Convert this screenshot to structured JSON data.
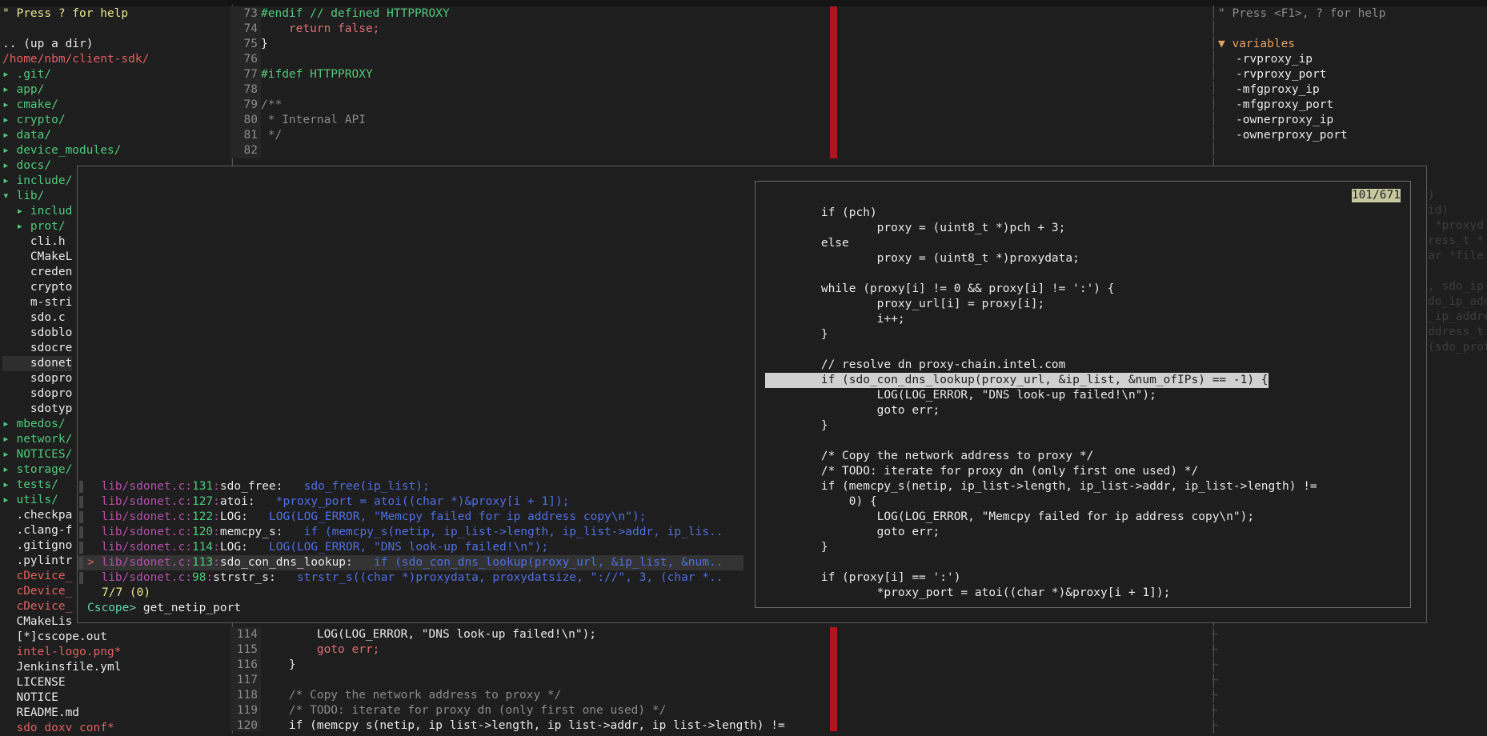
{
  "colors": {
    "background": "#1e1e1e",
    "directory": "#4ec97b",
    "path": "#e06060",
    "keyword": "#e06c75",
    "comment": "#8a8a8a",
    "cursor_bar": "#b0141c",
    "match_file": "#b54ea8",
    "match_text": "#4f6fe3"
  },
  "nerdtree": {
    "help": "\" Press ? for help",
    "up_dir": ".. (up a dir)",
    "root": "/home/nbm/client-sdk/",
    "items": [
      "▸ .git/",
      "▸ app/",
      "▸ cmake/",
      "▸ crypto/",
      "▸ data/",
      "▸ device_modules/",
      "▸ docs/",
      "▸ include/",
      "▾ lib/",
      "  ▸ includ",
      "  ▸ prot/",
      "    cli.h",
      "    CMakeL",
      "    creden",
      "    crypto",
      "    m-stri",
      "    sdo.c",
      "    sdoblo",
      "    sdocre",
      "    sdonet",
      "    sdopro",
      "    sdopro",
      "    sdotyp",
      "▸ mbedos/",
      "▸ network/",
      "▸ NOTICES/",
      "▸ storage/",
      "▸ tests/",
      "▸ utils/",
      "  .checkpa",
      "  .clang-f",
      "  .gitigno",
      "  .pylintr",
      "  cDevice_",
      "  cDevice_",
      "  cDevice_",
      "  CMakeLis",
      "  [*]cscope.out",
      "  intel-logo.png*",
      "  Jenkinsfile.yml",
      "  LICENSE",
      "  NOTICE",
      "  README.md",
      "  sdo_doxy_conf*"
    ]
  },
  "code_top": {
    "line_numbers": [
      "73",
      "74",
      "75",
      "76",
      "77",
      "78",
      "79",
      "80",
      "81",
      "82"
    ],
    "lines": [
      "#endif // defined HTTPPROXY",
      "    return false;",
      "}",
      "",
      "#ifdef HTTPPROXY",
      "",
      "/**",
      " * Internal API",
      " */",
      ""
    ]
  },
  "code_bottom": {
    "line_numbers": [
      "114",
      "115",
      "116",
      "117",
      "118",
      "119",
      "120"
    ],
    "lines": [
      "        LOG(LOG_ERROR, \"DNS look-up failed!\\n\");",
      "        goto err;",
      "    }",
      "",
      "    /* Copy the network address to proxy */",
      "    /* TODO: iterate for proxy dn (only first one used) */",
      "    if (memcpy_s(netip, ip_list->length, ip_list->addr, ip_list->length) !="
    ]
  },
  "tagbar": {
    "help": "\" Press <F1>, ? for help",
    "section": "▼ variables",
    "items": [
      "-rvproxy_ip",
      "-rvproxy_port",
      "-mfgproxy_ip",
      "-mfgproxy_port",
      "-ownerproxy_ip",
      "-ownerproxy_port"
    ]
  },
  "bg_fragments": [
    ")",
    "id)",
    " *proxyd",
    "ress_t *",
    "ar *file",
    "",
    ", sdo_ip",
    "do_ip_add",
    "_ip_addre",
    "ddress_t",
    "(sdo_prot"
  ],
  "fzf": {
    "results": [
      {
        "file": "lib/sdonet.c",
        "line": "131",
        "sym": "sdo_free",
        "text": "   sdo_free(ip_list);"
      },
      {
        "file": "lib/sdonet.c",
        "line": "127",
        "sym": "atoi",
        "text": "   *proxy_port = atoi((char *)&proxy[i + 1]);"
      },
      {
        "file": "lib/sdonet.c",
        "line": "122",
        "sym": "LOG",
        "text": "   LOG(LOG_ERROR, \"Memcpy failed for ip address copy\\n\");"
      },
      {
        "file": "lib/sdonet.c",
        "line": "120",
        "sym": "memcpy_s",
        "text": "   if (memcpy_s(netip, ip_list->length, ip_list->addr, ip_lis.."
      },
      {
        "file": "lib/sdonet.c",
        "line": "114",
        "sym": "LOG",
        "text": "   LOG(LOG_ERROR, \"DNS look-up failed!\\n\");"
      },
      {
        "file": "lib/sdonet.c",
        "line": "113",
        "sym": "sdo_con_dns_lookup",
        "text": "   if (sdo_con_dns_lookup(proxy_url, &ip_list, &num.."
      },
      {
        "file": "lib/sdonet.c",
        "line": "98",
        "sym": "strstr_s",
        "text": "   strstr_s((char *)proxydata, proxydatsize, \"://\", 3, (char *.."
      }
    ],
    "selected_index": 5,
    "count": "7/7 (0)",
    "prompt": "Cscope> ",
    "query": "get_netip_port"
  },
  "preview": {
    "position": "101/671",
    "highlight_index": 11,
    "lines": [
      "        if (pch)",
      "                proxy = (uint8_t *)pch + 3;",
      "        else",
      "                proxy = (uint8_t *)proxydata;",
      "",
      "        while (proxy[i] != 0 && proxy[i] != ':') {",
      "                proxy_url[i] = proxy[i];",
      "                i++;",
      "        }",
      "",
      "        // resolve dn proxy-chain.intel.com",
      "        if (sdo_con_dns_lookup(proxy_url, &ip_list, &num_ofIPs) == -1) {",
      "                LOG(LOG_ERROR, \"DNS look-up failed!\\n\");",
      "                goto err;",
      "        }",
      "",
      "        /* Copy the network address to proxy */",
      "        /* TODO: iterate for proxy dn (only first one used) */",
      "        if (memcpy_s(netip, ip_list->length, ip_list->addr, ip_list->length) !=",
      "            0) {",
      "                LOG(LOG_ERROR, \"Memcpy failed for ip address copy\\n\");",
      "                goto err;",
      "        }",
      "",
      "        if (proxy[i] == ':')",
      "                *proxy_port = atoi((char *)&proxy[i + 1]);"
    ]
  }
}
